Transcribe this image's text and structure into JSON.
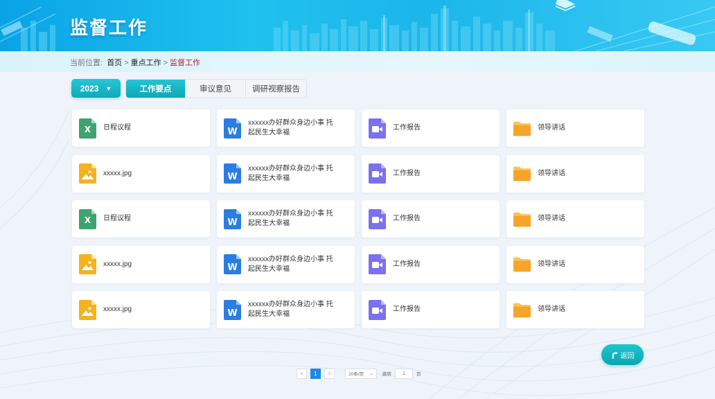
{
  "header": {
    "title": "监督工作"
  },
  "breadcrumb": {
    "prefix": "当前位置:",
    "items": [
      {
        "label": "首页"
      },
      {
        "label": "重点工作"
      },
      {
        "label": "监督工作"
      }
    ],
    "separator": ">"
  },
  "year_select": {
    "value": "2023",
    "arrow": "▼"
  },
  "tabs": [
    {
      "label": "工作要点",
      "active": true
    },
    {
      "label": "审议意见",
      "active": false
    },
    {
      "label": "调研视察报告",
      "active": false
    }
  ],
  "files": [
    {
      "name": "日程议程",
      "icon": "excel-icon"
    },
    {
      "name": "xxxxxx办好群众身边小事 托起民生大幸福",
      "icon": "word-icon"
    },
    {
      "name": "工作报告",
      "icon": "video-icon"
    },
    {
      "name": "领导讲话",
      "icon": "folder-icon"
    },
    {
      "name": "xxxxx.jpg",
      "icon": "image-icon"
    },
    {
      "name": "xxxxxx办好群众身边小事 托起民生大幸福",
      "icon": "word-icon"
    },
    {
      "name": "工作报告",
      "icon": "video-icon"
    },
    {
      "name": "领导讲话",
      "icon": "folder-icon"
    },
    {
      "name": "日程议程",
      "icon": "excel-icon"
    },
    {
      "name": "xxxxxx办好群众身边小事 托起民生大幸福",
      "icon": "word-icon"
    },
    {
      "name": "工作报告",
      "icon": "video-icon"
    },
    {
      "name": "领导讲话",
      "icon": "folder-icon"
    },
    {
      "name": "xxxxx.jpg",
      "icon": "image-icon"
    },
    {
      "name": "xxxxxx办好群众身边小事 托起民生大幸福",
      "icon": "word-icon"
    },
    {
      "name": "工作报告",
      "icon": "video-icon"
    },
    {
      "name": "领导讲话",
      "icon": "folder-icon"
    },
    {
      "name": "xxxxx.jpg",
      "icon": "image-icon"
    },
    {
      "name": "xxxxxx办好群众身边小事 托起民生大幸福",
      "icon": "word-icon"
    },
    {
      "name": "工作报告",
      "icon": "video-icon"
    },
    {
      "name": "领导讲话",
      "icon": "folder-icon"
    }
  ],
  "back_button": {
    "label": "返回",
    "icon": "return-arrow-icon"
  },
  "pagination": {
    "prev": "<",
    "current_page": "1",
    "next": ">",
    "page_size": "20条/页",
    "goto_label": "跳转",
    "goto_value": "1",
    "page_unit": "页"
  },
  "colors": {
    "accent": "#13b3c2",
    "breadcrumb_current": "#b5232b",
    "pager_active": "#1e88e5",
    "excel": "#3fa36f",
    "word": "#2a7de1",
    "video": "#7c6ff0",
    "image": "#f5b21c",
    "folder": "#f7a42a"
  }
}
